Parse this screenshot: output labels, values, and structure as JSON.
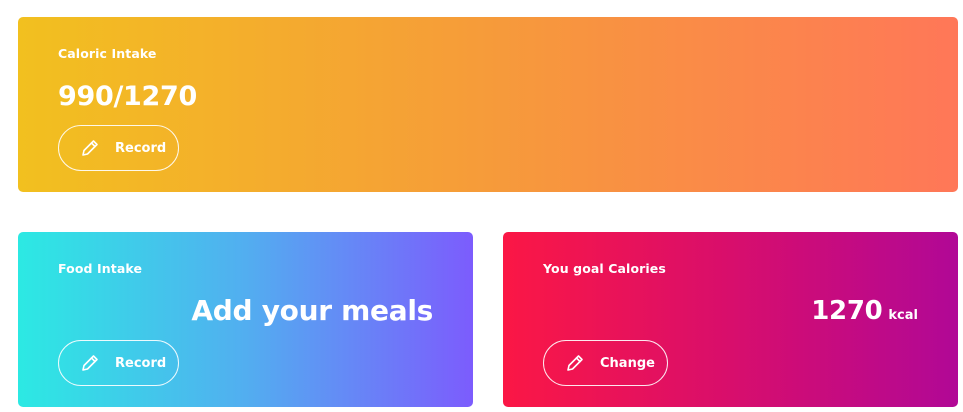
{
  "caloric_intake": {
    "label": "Caloric Intake",
    "value": "990/1270",
    "button_label": "Record",
    "button_icon": "pencil-icon"
  },
  "food_intake": {
    "label": "Food Intake",
    "headline": "Add your meals",
    "button_label": "Record",
    "button_icon": "pencil-icon"
  },
  "goal_calories": {
    "label": "You goal Calories",
    "value": "1270",
    "unit": "kcal",
    "button_label": "Change",
    "button_icon": "pencil-icon"
  },
  "colors": {
    "caloric_gradient": [
      "#f2c01f",
      "#ff7758"
    ],
    "food_gradient": [
      "#2ce9e3",
      "#7c5cfd"
    ],
    "goal_gradient": [
      "#fb1745",
      "#b10896"
    ]
  }
}
